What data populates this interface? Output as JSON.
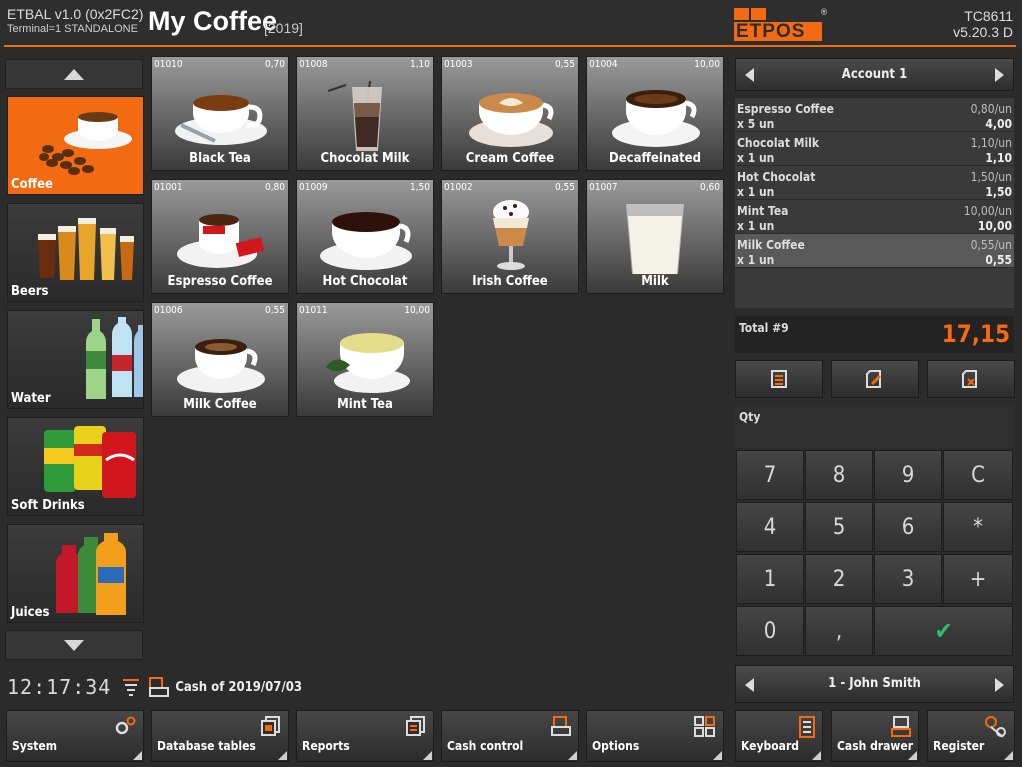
{
  "header": {
    "app_version": "ETBAL v1.0 (0x2FC2)",
    "terminal": "Terminal=1 STANDALONE",
    "shop_name": "My Coffee",
    "year": "[2019]",
    "logo_text": "ETPOS",
    "logo_mark": "®",
    "device_id": "TC8611",
    "software_version": "v5.20.3 D"
  },
  "categories": [
    {
      "label": "Coffee",
      "icon": "coffee-icon",
      "active": true
    },
    {
      "label": "Beers",
      "icon": "beer-glasses-icon",
      "active": false
    },
    {
      "label": "Water",
      "icon": "water-bottles-icon",
      "active": false
    },
    {
      "label": "Soft Drinks",
      "icon": "soda-cans-icon",
      "active": false
    },
    {
      "label": "Juices",
      "icon": "juice-bottles-icon",
      "active": false
    }
  ],
  "products": [
    {
      "code": "01010",
      "price": "0,70",
      "name": "Black Tea",
      "icon": "black-tea-cup-icon"
    },
    {
      "code": "01008",
      "price": "1,10",
      "name": "Chocolat Milk",
      "icon": "chocolate-milk-glass-icon"
    },
    {
      "code": "01003",
      "price": "0,55",
      "name": "Cream Coffee",
      "icon": "cream-coffee-cup-icon"
    },
    {
      "code": "01004",
      "price": "10,00",
      "name": "Decaffeinated",
      "icon": "decaf-coffee-cup-icon"
    },
    {
      "code": "01001",
      "price": "0,80",
      "name": "Espresso Coffee",
      "icon": "espresso-cup-icon"
    },
    {
      "code": "01009",
      "price": "1,50",
      "name": "Hot Chocolat",
      "icon": "hot-chocolate-cup-icon"
    },
    {
      "code": "01002",
      "price": "0,55",
      "name": "Irish Coffee",
      "icon": "irish-coffee-glass-icon"
    },
    {
      "code": "01007",
      "price": "0,60",
      "name": "Milk",
      "icon": "milk-glass-icon"
    },
    {
      "code": "01006",
      "price": "0,55",
      "name": "Milk Coffee",
      "icon": "milk-coffee-cup-icon"
    },
    {
      "code": "01011",
      "price": "10,00",
      "name": "Mint Tea",
      "icon": "mint-tea-cup-icon"
    }
  ],
  "status": {
    "clock": "12:17:34",
    "cash_label": "Cash of 2019/07/03"
  },
  "bottom_buttons": [
    {
      "label": "System",
      "icon": "gears-icon"
    },
    {
      "label": "Database tables",
      "icon": "database-tables-icon"
    },
    {
      "label": "Reports",
      "icon": "reports-icon"
    },
    {
      "label": "Cash control",
      "icon": "cash-control-icon"
    },
    {
      "label": "Options",
      "icon": "options-grid-icon"
    },
    {
      "label": "Keyboard",
      "icon": "keyboard-icon"
    },
    {
      "label": "Cash drawer",
      "icon": "cash-drawer-icon"
    },
    {
      "label": "Register",
      "icon": "register-user-icon"
    }
  ],
  "account": {
    "label": "Account 1"
  },
  "ticket_lines": [
    {
      "name": "Espresso Coffee",
      "unit_price": "0,80/un",
      "qty": "x 5 un",
      "amount": "4,00",
      "selected": false
    },
    {
      "name": "Chocolat Milk",
      "unit_price": "1,10/un",
      "qty": "x 1 un",
      "amount": "1,10",
      "selected": false
    },
    {
      "name": "Hot Chocolat",
      "unit_price": "1,50/un",
      "qty": "x 1 un",
      "amount": "1,50",
      "selected": false
    },
    {
      "name": "Mint Tea",
      "unit_price": "10,00/un",
      "qty": "x 1 un",
      "amount": "10,00",
      "selected": false
    },
    {
      "name": "Milk Coffee",
      "unit_price": "0,55/un",
      "qty": "x 1 un",
      "amount": "0,55",
      "selected": true
    }
  ],
  "total": {
    "label": "Total #9",
    "value": "17,15"
  },
  "qty_label": "Qty",
  "keypad": [
    "7",
    "8",
    "9",
    "C",
    "4",
    "5",
    "6",
    "*",
    "1",
    "2",
    "3",
    "+",
    "0",
    ",",
    "✔"
  ],
  "operator": {
    "label": "1 - John Smith"
  },
  "colors": {
    "accent": "#f26a11",
    "confirm": "#2dbf6e"
  }
}
